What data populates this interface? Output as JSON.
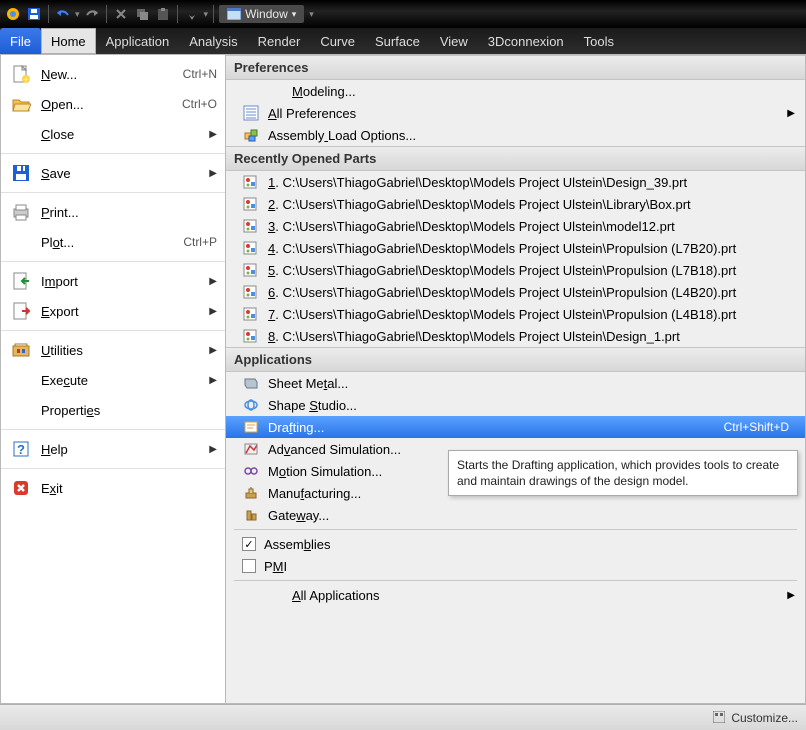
{
  "titlebar": {
    "window_label": "Window"
  },
  "tabs": [
    "File",
    "Home",
    "Application",
    "Analysis",
    "Render",
    "Curve",
    "Surface",
    "View",
    "3Dconnexion",
    "Tools"
  ],
  "file_menu": {
    "groups": [
      [
        {
          "label": "New...",
          "u": 0,
          "shortcut": "Ctrl+N",
          "icon": "new-icon"
        },
        {
          "label": "Open...",
          "u": 0,
          "shortcut": "Ctrl+O",
          "icon": "open-icon"
        },
        {
          "label": "Close",
          "u": 0,
          "sub": true
        }
      ],
      [
        {
          "label": "Save",
          "u": 0,
          "sub": true,
          "icon": "save-icon"
        }
      ],
      [
        {
          "label": "Print...",
          "u": 0,
          "icon": "print-icon"
        },
        {
          "label": "Plot...",
          "u": 2,
          "shortcut": "Ctrl+P"
        }
      ],
      [
        {
          "label": "Import",
          "u": 1,
          "sub": true,
          "icon": "import-icon"
        },
        {
          "label": "Export",
          "u": 0,
          "sub": true,
          "icon": "export-icon"
        }
      ],
      [
        {
          "label": "Utilities",
          "u": 0,
          "sub": true,
          "icon": "utilities-icon"
        },
        {
          "label": "Execute",
          "u": 3,
          "sub": true
        },
        {
          "label": "Properties",
          "u": 8
        }
      ],
      [
        {
          "label": "Help",
          "u": 0,
          "sub": true,
          "icon": "help-icon"
        }
      ],
      [
        {
          "label": "Exit",
          "u": 1,
          "icon": "exit-icon"
        }
      ]
    ]
  },
  "preferences": {
    "header": "Preferences",
    "items": [
      {
        "label": "Modeling...",
        "u": 0
      },
      {
        "label": "All Preferences",
        "u": 0,
        "sub": true,
        "icon": "list-icon"
      },
      {
        "label": "Assembly Load Options...",
        "u": 8,
        "icon": "assembly-icon"
      }
    ]
  },
  "recent": {
    "header": "Recently Opened Parts",
    "items": [
      {
        "num": "1",
        "path": "C:\\Users\\ThiagoGabriel\\Desktop\\Models Project Ulstein\\Design_39.prt"
      },
      {
        "num": "2",
        "path": "C:\\Users\\ThiagoGabriel\\Desktop\\Models Project Ulstein\\Library\\Box.prt"
      },
      {
        "num": "3",
        "path": "C:\\Users\\ThiagoGabriel\\Desktop\\Models Project Ulstein\\model12.prt"
      },
      {
        "num": "4",
        "path": "C:\\Users\\ThiagoGabriel\\Desktop\\Models Project Ulstein\\Propulsion (L7B20).prt"
      },
      {
        "num": "5",
        "path": "C:\\Users\\ThiagoGabriel\\Desktop\\Models Project Ulstein\\Propulsion (L7B18).prt"
      },
      {
        "num": "6",
        "path": "C:\\Users\\ThiagoGabriel\\Desktop\\Models Project Ulstein\\Propulsion (L4B20).prt"
      },
      {
        "num": "7",
        "path": "C:\\Users\\ThiagoGabriel\\Desktop\\Models Project Ulstein\\Propulsion (L4B18).prt"
      },
      {
        "num": "8",
        "path": "C:\\Users\\ThiagoGabriel\\Desktop\\Models Project Ulstein\\Design_1.prt"
      }
    ]
  },
  "applications": {
    "header": "Applications",
    "items": [
      {
        "label": "Sheet Metal...",
        "u": 8,
        "icon": "sheetmetal-icon"
      },
      {
        "label": "Shape Studio...",
        "u": 6,
        "icon": "shapestudio-icon"
      },
      {
        "label": "Drafting...",
        "u": 3,
        "icon": "drafting-icon",
        "shortcut": "Ctrl+Shift+D",
        "selected": true
      },
      {
        "label": "Advanced Simulation...",
        "u": 2,
        "icon": "advsim-icon"
      },
      {
        "label": "Motion Simulation...",
        "u": 1,
        "icon": "motion-icon"
      },
      {
        "label": "Manufacturing...",
        "u": 4,
        "icon": "manufacturing-icon"
      },
      {
        "label": "Gateway...",
        "u": 4,
        "icon": "gateway-icon"
      }
    ],
    "toggles": [
      {
        "label": "Assemblies",
        "u": 5,
        "checked": true
      },
      {
        "label": "PMI",
        "u": 1,
        "checked": false
      }
    ],
    "footer": {
      "label": "All Applications",
      "u": 0,
      "sub": true
    }
  },
  "tooltip": "Starts the Drafting application, which provides tools to create and maintain drawings of the design model.",
  "footer": {
    "customize": "Customize..."
  }
}
